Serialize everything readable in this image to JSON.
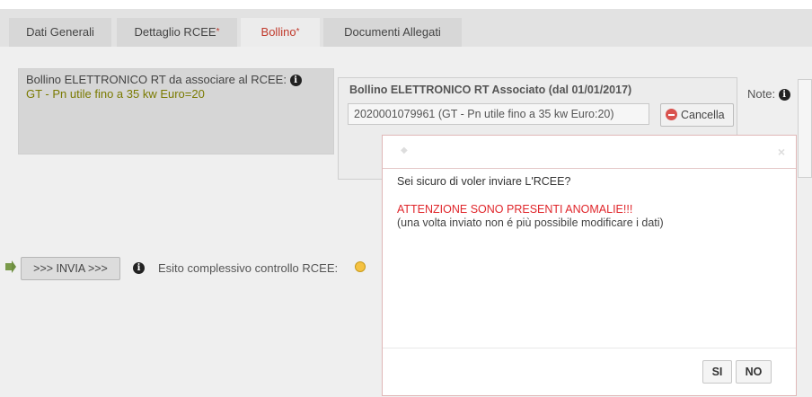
{
  "tabs": [
    {
      "label": "Dati Generali",
      "star": ""
    },
    {
      "label": "Dettaglio RCEE",
      "star": "*"
    },
    {
      "label": "Bollino",
      "star": "*"
    },
    {
      "label": "Documenti Allegati",
      "star": ""
    }
  ],
  "bollino_left": {
    "title": "Bollino ELETTRONICO RT da associare al RCEE:",
    "value": "GT - Pn utile fino a 35 kw Euro=20"
  },
  "bollino_assoc": {
    "title": "Bollino ELETTRONICO RT Associato (dal 01/01/2017)",
    "code": "2020001079961  (GT - Pn utile fino a 35 kw Euro:20)",
    "cancel_label": "Cancella"
  },
  "note_label": "Note:",
  "send": {
    "button_label": ">>> INVIA >>>",
    "esito_text": "Esito complessivo controllo RCEE:"
  },
  "modal": {
    "question": "Sei sicuro di voler inviare L'RCEE?",
    "warning": "ATTENZIONE SONO PRESENTI ANOMALIE!!!",
    "note": "(una volta inviato non é più possibile modificare i dati)",
    "yes_label": "SI",
    "no_label": "NO",
    "close_glyph": "×"
  },
  "colors": {
    "active_tab_text": "#c0392b",
    "warning_text": "#e0262b",
    "value_text": "#7a7a00"
  }
}
